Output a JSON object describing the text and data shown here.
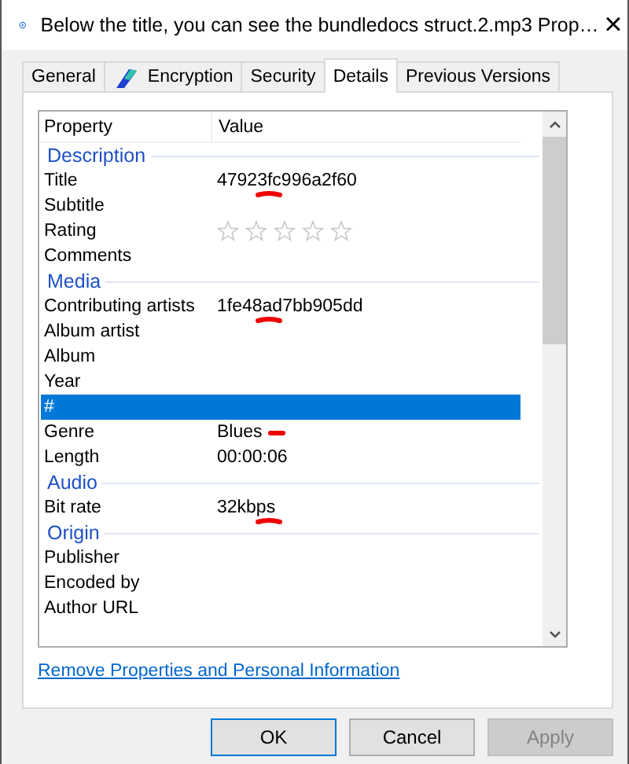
{
  "window": {
    "title": "Below the title, you can see the bundledocs struct.2.mp3 Prop…",
    "close": "×"
  },
  "tabs": [
    {
      "label": "General",
      "selected": false,
      "icon": false
    },
    {
      "label": "Encryption",
      "selected": false,
      "icon": true
    },
    {
      "label": "Security",
      "selected": false,
      "icon": false
    },
    {
      "label": "Details",
      "selected": true,
      "icon": false
    },
    {
      "label": "Previous Versions",
      "selected": false,
      "icon": false
    }
  ],
  "table": {
    "columns": [
      "Property",
      "Value"
    ],
    "rows": [
      {
        "kind": "group",
        "label": "Description"
      },
      {
        "kind": "prop",
        "property": "Title",
        "value": "47923fc996a2f60",
        "selected": false,
        "marked": true,
        "mark_beside": false
      },
      {
        "kind": "prop",
        "property": "Subtitle",
        "selected": false
      },
      {
        "kind": "rating",
        "property": "Rating",
        "stars": 0,
        "selected": false
      },
      {
        "kind": "prop",
        "property": "Comments",
        "selected": false
      },
      {
        "kind": "group",
        "label": "Media"
      },
      {
        "kind": "prop",
        "property": "Contributing artists",
        "value": "1fe48ad7bb905dd",
        "selected": false,
        "marked": true,
        "mark_beside": false
      },
      {
        "kind": "prop",
        "property": "Album artist",
        "selected": false
      },
      {
        "kind": "prop",
        "property": "Album",
        "selected": false
      },
      {
        "kind": "prop",
        "property": "Year",
        "selected": false
      },
      {
        "kind": "prop",
        "property": "#",
        "selected": true
      },
      {
        "kind": "prop",
        "property": "Genre",
        "value": "Blues",
        "selected": false,
        "marked": true,
        "mark_beside": true
      },
      {
        "kind": "prop",
        "property": "Length",
        "value": "00:00:06",
        "selected": false
      },
      {
        "kind": "group",
        "label": "Audio"
      },
      {
        "kind": "prop",
        "property": "Bit rate",
        "value": "32kbps",
        "selected": false,
        "marked": true,
        "mark_beside": false
      },
      {
        "kind": "group",
        "label": "Origin"
      },
      {
        "kind": "prop",
        "property": "Publisher",
        "selected": false
      },
      {
        "kind": "prop",
        "property": "Encoded by",
        "selected": false
      },
      {
        "kind": "prop",
        "property": "Author URL",
        "selected": false
      }
    ]
  },
  "link": "Remove Properties and Personal Information",
  "buttons": [
    {
      "label": "OK",
      "kind": "default"
    },
    {
      "label": "Cancel",
      "kind": "normal"
    },
    {
      "label": "Apply",
      "kind": "disabled"
    }
  ]
}
